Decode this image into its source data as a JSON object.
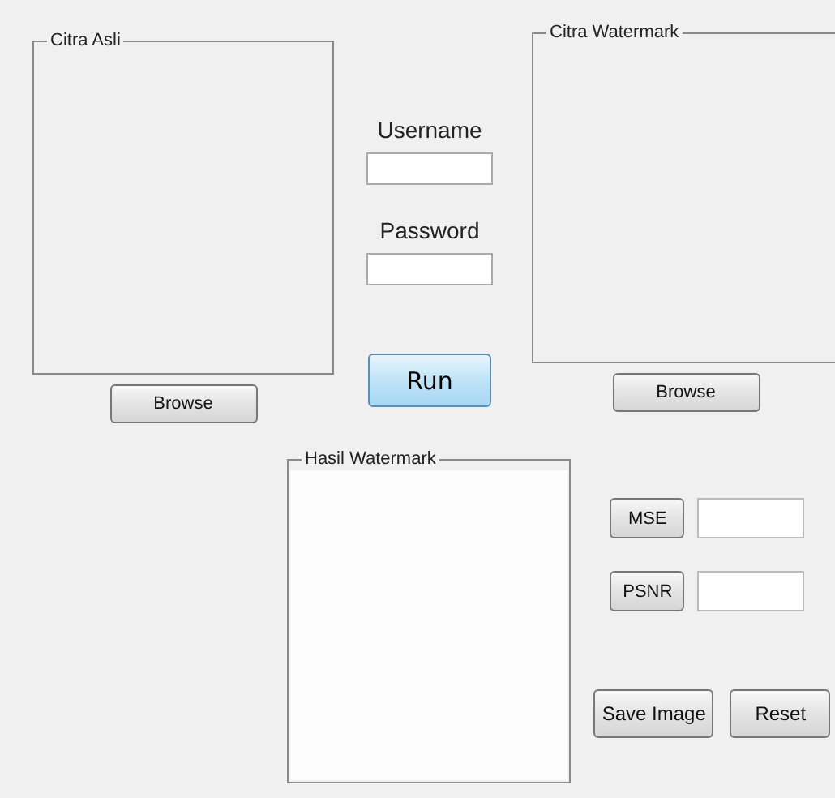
{
  "panels": [
    {
      "title": "Citra Asli",
      "button": "Browse"
    },
    {
      "title": "Citra Watermark",
      "button": "Browse"
    }
  ],
  "login": {
    "username_label": "Username",
    "password_label": "Password",
    "run_button": "Run"
  },
  "result_panel": {
    "title": "Hasil Watermark"
  },
  "metrics": [
    {
      "button": "MSE"
    },
    {
      "button": "PSNR"
    }
  ],
  "actions": [
    "Save Image",
    "Reset"
  ]
}
